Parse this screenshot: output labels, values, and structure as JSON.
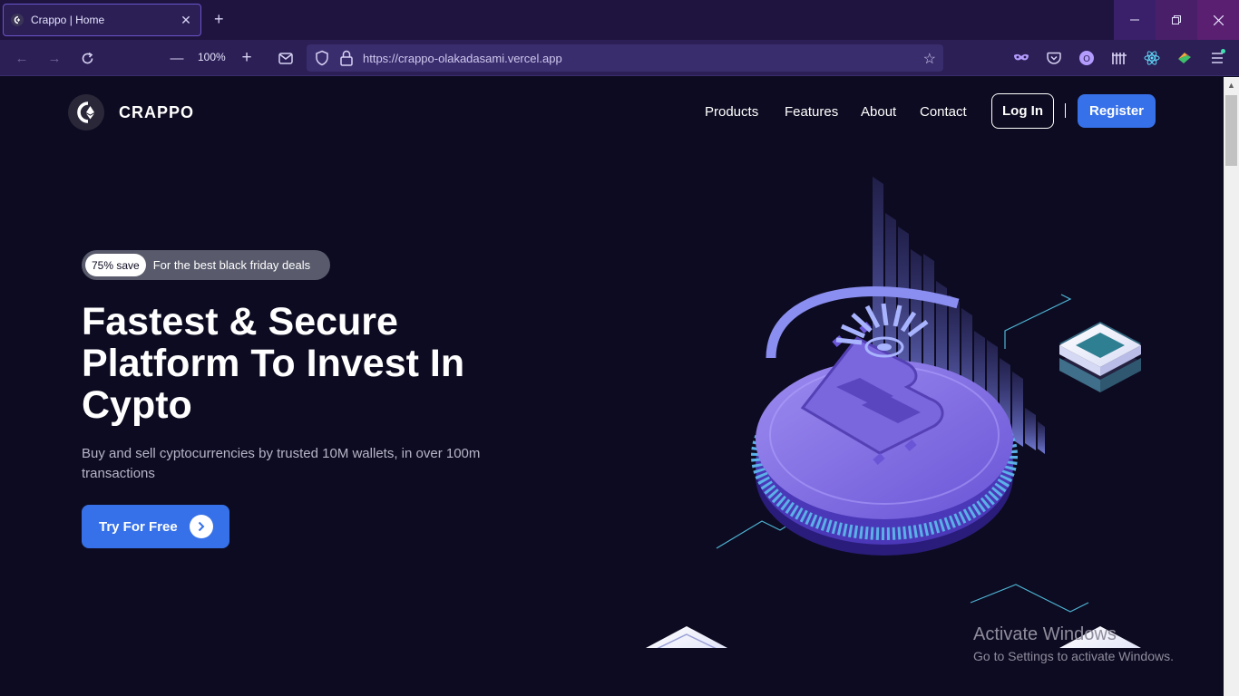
{
  "browser": {
    "tab_title": "Crappo | Home",
    "zoom": "100%",
    "url": "https://crappo-olakadasami.vercel.app"
  },
  "site": {
    "brand": "CRAPPO",
    "nav": [
      "Products",
      "Features",
      "About",
      "Contact"
    ],
    "login": "Log In",
    "register": "Register"
  },
  "hero": {
    "badge_pill": "75% save",
    "badge_text": "For the best black friday deals",
    "headline_1": "Fastest & Secure",
    "headline_2": "Platform To Invest In",
    "headline_3": "Cypto",
    "subtext": "Buy and sell cyptocurrencies by trusted 10M wallets, in over 100m transactions",
    "cta": "Try For Free"
  },
  "watermark": {
    "title": "Activate Windows",
    "subtitle": "Go to Settings to activate Windows."
  },
  "colors": {
    "page_bg": "#0d0b21",
    "accent": "#3671e9",
    "chrome": "#2b1f55"
  }
}
